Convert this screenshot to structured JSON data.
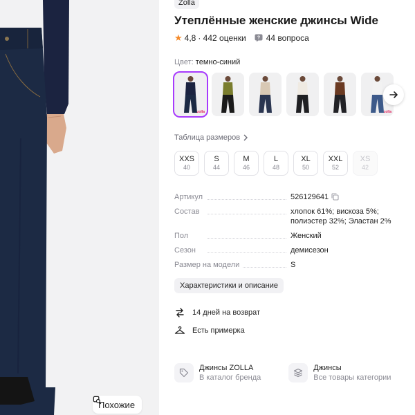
{
  "photo": {
    "similar_label": "Похожие",
    "jeans_color": "#1c2a44",
    "sweater_color": "#1b2340",
    "skin_color": "#d9a98c",
    "bg_color": "#f2f2f3"
  },
  "product": {
    "brand_badge": "Zolla",
    "title": "Утеплённые женские джинсы Wide",
    "rating": "4,8",
    "rating_count": "· 442 оценки",
    "questions": "44 вопроса",
    "color_label": "Цвет:",
    "color_value": "темно-синий",
    "swatches": [
      {
        "name": "dark-blue-jeans",
        "top": "#1b2340",
        "bottom": "#1c2a44",
        "active": true,
        "brand": "zolla"
      },
      {
        "name": "olive-sweater-black-jeans",
        "top": "#7a7d2e",
        "bottom": "#1a1a1a",
        "active": false,
        "brand": ""
      },
      {
        "name": "beige-sweater-blue-jeans",
        "top": "#d8c8b4",
        "bottom": "#2a3550",
        "active": false,
        "brand": ""
      },
      {
        "name": "white-sweater-black-jeans",
        "top": "#efeae2",
        "bottom": "#1f1f22",
        "active": false,
        "brand": ""
      },
      {
        "name": "brown-scarf-black-jeans",
        "top": "#6a3a22",
        "bottom": "#222226",
        "active": false,
        "brand": ""
      },
      {
        "name": "white-shirt-blue-jeans",
        "top": "#f2f2f2",
        "bottom": "#3d5a8a",
        "active": false,
        "brand": "zolla"
      }
    ],
    "sizes_link": "Таблица размеров",
    "sizes": [
      {
        "ru": "XXS",
        "eu": "40",
        "disabled": false
      },
      {
        "ru": "S",
        "eu": "44",
        "disabled": false
      },
      {
        "ru": "M",
        "eu": "46",
        "disabled": false
      },
      {
        "ru": "L",
        "eu": "48",
        "disabled": false
      },
      {
        "ru": "XL",
        "eu": "50",
        "disabled": false
      },
      {
        "ru": "XXL",
        "eu": "52",
        "disabled": false
      },
      {
        "ru": "XS",
        "eu": "42",
        "disabled": true
      }
    ],
    "specs": [
      {
        "key": "Артикул",
        "value": "526129641",
        "copy": true
      },
      {
        "key": "Состав",
        "value": "хлопок 61%; вискоза 5%; полиэстер 32%; Эластан 2%",
        "copy": false
      },
      {
        "key": "Пол",
        "value": "Женский",
        "copy": false
      },
      {
        "key": "Сезон",
        "value": "демисезон",
        "copy": false
      },
      {
        "key": "Размер на модели",
        "value": "S",
        "copy": false
      }
    ],
    "chars_button": "Характеристики и описание",
    "features": [
      {
        "icon": "return-arrows-icon",
        "label": "14 дней на возврат"
      },
      {
        "icon": "hanger-icon",
        "label": "Есть примерка"
      }
    ],
    "links": [
      {
        "icon": "tag-icon",
        "title": "Джинсы ZOLLA",
        "subtitle": "В каталог бренда"
      },
      {
        "icon": "stack-icon",
        "title": "Джинсы",
        "subtitle": "Все товары категории"
      }
    ],
    "accent_color": "#a73afd",
    "star_color": "#f58a2a"
  }
}
